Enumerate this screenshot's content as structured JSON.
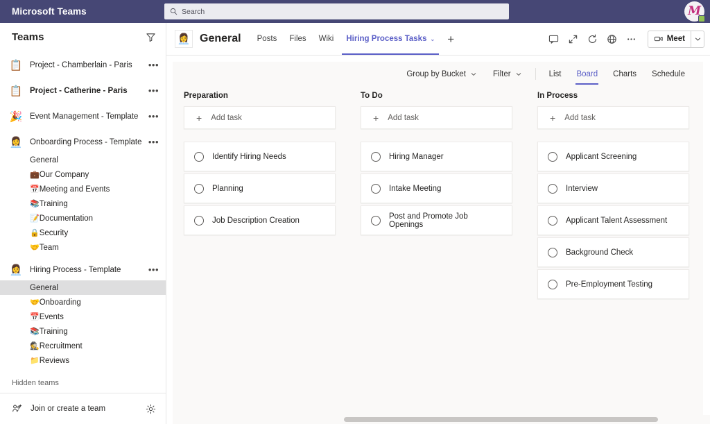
{
  "app": {
    "brand": "Microsoft Teams"
  },
  "search": {
    "placeholder": "Search",
    "icon": "search-icon"
  },
  "user": {
    "avatar_letter": "M",
    "presence": "available"
  },
  "sidebar": {
    "title": "Teams",
    "filter_icon": "filter-icon",
    "teams": [
      {
        "emoji": "📋",
        "name": "Project - Chamberlain - Paris",
        "bold": false,
        "more": "•••",
        "channels": []
      },
      {
        "emoji": "📋",
        "name": "Project - Catherine - Paris",
        "bold": true,
        "more": "•••",
        "channels": []
      },
      {
        "emoji": "🎉",
        "name": "Event Management - Template",
        "bold": false,
        "more": "•••",
        "channels": []
      },
      {
        "emoji": "👩‍💼",
        "name": "Onboarding Process - Template",
        "bold": false,
        "more": "•••",
        "channels": [
          {
            "emoji": "",
            "name": "General",
            "selected": false
          },
          {
            "emoji": "💼",
            "name": "Our Company",
            "selected": false
          },
          {
            "emoji": "📅",
            "name": "Meeting and Events",
            "selected": false
          },
          {
            "emoji": "📚",
            "name": "Training",
            "selected": false
          },
          {
            "emoji": "📝",
            "name": "Documentation",
            "selected": false
          },
          {
            "emoji": "🔒",
            "name": "Security",
            "selected": false
          },
          {
            "emoji": "🤝",
            "name": "Team",
            "selected": false
          }
        ]
      },
      {
        "emoji": "👩‍💼",
        "name": "Hiring Process - Template",
        "bold": false,
        "more": "•••",
        "channels": [
          {
            "emoji": "",
            "name": "General",
            "selected": true
          },
          {
            "emoji": "🤝",
            "name": "Onboarding",
            "selected": false
          },
          {
            "emoji": "📅",
            "name": "Events",
            "selected": false
          },
          {
            "emoji": "📚",
            "name": "Training",
            "selected": false
          },
          {
            "emoji": "🕵️",
            "name": "Recruitment",
            "selected": false
          },
          {
            "emoji": "📁",
            "name": "Reviews",
            "selected": false
          }
        ]
      }
    ],
    "hidden_teams_label": "Hidden teams",
    "join_label": "Join or create a team",
    "join_icon": "add-team-icon",
    "settings_icon": "gear-icon"
  },
  "channel_header": {
    "avatar_emoji": "👩‍💼",
    "title": "General",
    "tabs": [
      {
        "label": "Posts",
        "active": false,
        "caret": false
      },
      {
        "label": "Files",
        "active": false,
        "caret": false
      },
      {
        "label": "Wiki",
        "active": false,
        "caret": false
      },
      {
        "label": "Hiring Process Tasks",
        "active": true,
        "caret": true
      }
    ],
    "add_tab": "+",
    "tools": [
      {
        "name": "chat-icon"
      },
      {
        "name": "expand-icon"
      },
      {
        "name": "refresh-icon"
      },
      {
        "name": "globe-icon"
      },
      {
        "name": "more-options-icon"
      }
    ],
    "meet_label": "Meet",
    "meet_icon": "video-camera-icon",
    "meet_caret_icon": "chevron-down-icon"
  },
  "planner": {
    "group_by_label": "Group by Bucket",
    "filter_label": "Filter",
    "views": [
      {
        "label": "List",
        "active": false
      },
      {
        "label": "Board",
        "active": true
      },
      {
        "label": "Charts",
        "active": false
      },
      {
        "label": "Schedule",
        "active": false
      }
    ],
    "add_task_label": "Add task",
    "buckets": [
      {
        "title": "Preparation",
        "tasks": [
          {
            "label": "Identify Hiring Needs",
            "done": false
          },
          {
            "label": "Planning",
            "done": false
          },
          {
            "label": "Job Description Creation",
            "done": false
          }
        ]
      },
      {
        "title": "To Do",
        "tasks": [
          {
            "label": "Hiring Manager",
            "done": false
          },
          {
            "label": "Intake Meeting",
            "done": false
          },
          {
            "label": "Post and Promote Job Openings",
            "done": false
          }
        ]
      },
      {
        "title": "In Process",
        "tasks": [
          {
            "label": "Applicant Screening",
            "done": false
          },
          {
            "label": "Interview",
            "done": false
          },
          {
            "label": "Applicant Talent Assessment",
            "done": false
          },
          {
            "label": "Background Check",
            "done": false
          },
          {
            "label": "Pre-Employment Testing",
            "done": false
          }
        ]
      }
    ]
  },
  "colors": {
    "topbar": "#464775",
    "accent": "#5b5fc7",
    "board_bg": "#faf9f8",
    "card_bg": "#ffffff",
    "selected_channel": "#dededf",
    "presence_green": "#92c353"
  }
}
